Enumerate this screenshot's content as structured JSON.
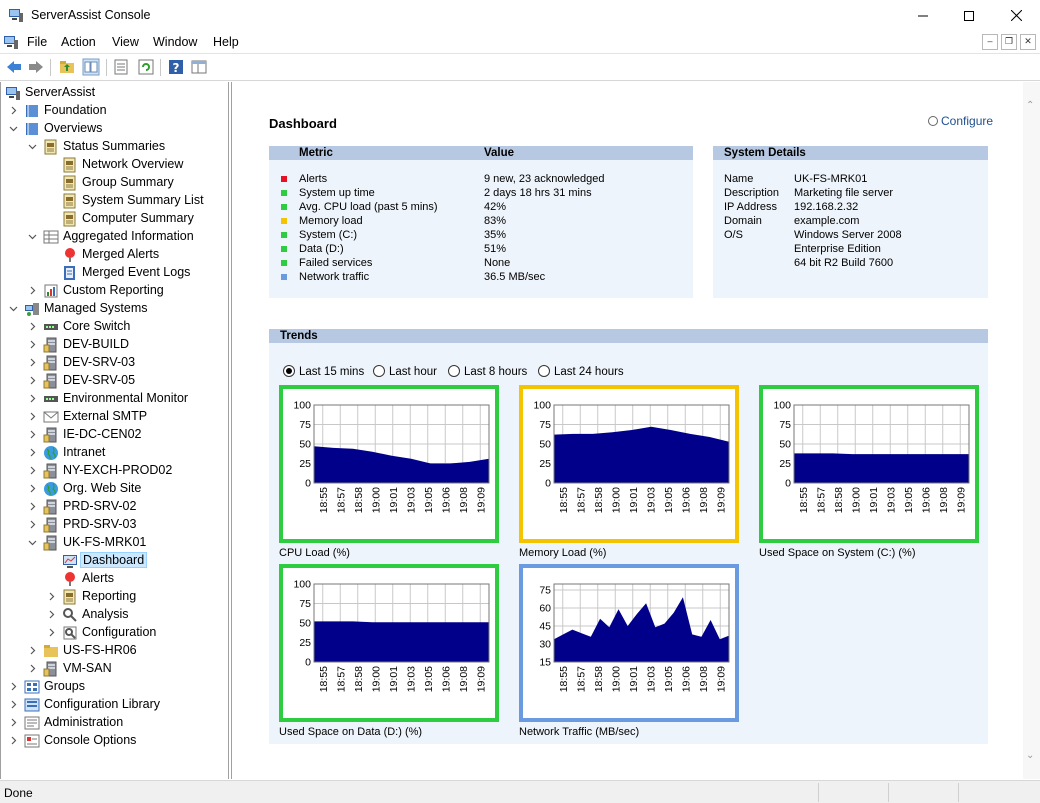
{
  "window": {
    "title": "ServerAssist Console"
  },
  "menu": [
    "File",
    "Action",
    "View",
    "Window",
    "Help"
  ],
  "toolbar": [
    "back-arrow-icon",
    "forward-arrow-icon",
    "up-folder-icon",
    "show-tree-icon",
    "properties-icon",
    "refresh-icon",
    "help-icon",
    "panel-icon"
  ],
  "tree": [
    {
      "label": "ServerAssist",
      "depth": 0,
      "twisty": "",
      "icon": "computer-icon"
    },
    {
      "label": "Foundation",
      "depth": 1,
      "twisty": "closed",
      "icon": "book-icon"
    },
    {
      "label": "Overviews",
      "depth": 1,
      "twisty": "open",
      "icon": "book-icon"
    },
    {
      "label": "Status Summaries",
      "depth": 2,
      "twisty": "open",
      "icon": "report-icon"
    },
    {
      "label": "Network Overview",
      "depth": 3,
      "twisty": "",
      "icon": "report-icon"
    },
    {
      "label": "Group Summary",
      "depth": 3,
      "twisty": "",
      "icon": "report-icon"
    },
    {
      "label": "System Summary List",
      "depth": 3,
      "twisty": "",
      "icon": "report-icon"
    },
    {
      "label": "Computer Summary",
      "depth": 3,
      "twisty": "",
      "icon": "report-icon"
    },
    {
      "label": "Aggregated Information",
      "depth": 2,
      "twisty": "open",
      "icon": "grid-icon"
    },
    {
      "label": "Merged Alerts",
      "depth": 3,
      "twisty": "",
      "icon": "alert-icon"
    },
    {
      "label": "Merged Event Logs",
      "depth": 3,
      "twisty": "",
      "icon": "event-log-icon"
    },
    {
      "label": "Custom Reporting",
      "depth": 2,
      "twisty": "closed",
      "icon": "chart-icon"
    },
    {
      "label": "Managed Systems",
      "depth": 1,
      "twisty": "open",
      "icon": "systems-icon"
    },
    {
      "label": "Core Switch",
      "depth": 2,
      "twisty": "closed",
      "icon": "switch-icon"
    },
    {
      "label": "DEV-BUILD",
      "depth": 2,
      "twisty": "closed",
      "icon": "server-icon"
    },
    {
      "label": "DEV-SRV-03",
      "depth": 2,
      "twisty": "closed",
      "icon": "server-icon"
    },
    {
      "label": "DEV-SRV-05",
      "depth": 2,
      "twisty": "closed",
      "icon": "server-icon"
    },
    {
      "label": "Environmental Monitor",
      "depth": 2,
      "twisty": "closed",
      "icon": "switch-icon"
    },
    {
      "label": "External SMTP",
      "depth": 2,
      "twisty": "closed",
      "icon": "mail-icon"
    },
    {
      "label": "IE-DC-CEN02",
      "depth": 2,
      "twisty": "closed",
      "icon": "server-icon"
    },
    {
      "label": "Intranet",
      "depth": 2,
      "twisty": "closed",
      "icon": "globe-icon"
    },
    {
      "label": "NY-EXCH-PROD02",
      "depth": 2,
      "twisty": "closed",
      "icon": "server-icon"
    },
    {
      "label": "Org. Web Site",
      "depth": 2,
      "twisty": "closed",
      "icon": "globe-icon"
    },
    {
      "label": "PRD-SRV-02",
      "depth": 2,
      "twisty": "closed",
      "icon": "server-icon"
    },
    {
      "label": "PRD-SRV-03",
      "depth": 2,
      "twisty": "closed",
      "icon": "server-icon"
    },
    {
      "label": "UK-FS-MRK01",
      "depth": 2,
      "twisty": "open",
      "icon": "server-icon"
    },
    {
      "label": "Dashboard",
      "depth": 3,
      "twisty": "",
      "icon": "dashboard-icon",
      "selected": true
    },
    {
      "label": "Alerts",
      "depth": 3,
      "twisty": "",
      "icon": "alert-icon"
    },
    {
      "label": "Reporting",
      "depth": 3,
      "twisty": "closed",
      "icon": "report-icon"
    },
    {
      "label": "Analysis",
      "depth": 3,
      "twisty": "closed",
      "icon": "analysis-icon"
    },
    {
      "label": "Configuration",
      "depth": 3,
      "twisty": "closed",
      "icon": "configuration-icon"
    },
    {
      "label": "US-FS-HR06",
      "depth": 2,
      "twisty": "closed",
      "icon": "folder-icon"
    },
    {
      "label": "VM-SAN",
      "depth": 2,
      "twisty": "closed",
      "icon": "server-icon"
    },
    {
      "label": "Groups",
      "depth": 1,
      "twisty": "closed",
      "icon": "groups-icon"
    },
    {
      "label": "Configuration Library",
      "depth": 1,
      "twisty": "closed",
      "icon": "library-icon"
    },
    {
      "label": "Administration",
      "depth": 1,
      "twisty": "closed",
      "icon": "admin-icon"
    },
    {
      "label": "Console Options",
      "depth": 1,
      "twisty": "closed",
      "icon": "options-icon"
    }
  ],
  "dashboard": {
    "title": "Dashboard",
    "configure_label": "Configure",
    "metrics_header": {
      "metric": "Metric",
      "value": "Value"
    },
    "metrics": [
      {
        "name": "Alerts",
        "value": "9 new, 23 acknowledged",
        "status": "#e81123"
      },
      {
        "name": "System up time",
        "value": "2 days 18 hrs 31 mins",
        "status": "#2ecc40"
      },
      {
        "name": "Avg. CPU load (past 5 mins)",
        "value": "42%",
        "status": "#2ecc40"
      },
      {
        "name": "Memory load",
        "value": "83%",
        "status": "#f5c400"
      },
      {
        "name": "System (C:)",
        "value": "35%",
        "status": "#2ecc40"
      },
      {
        "name": "Data (D:)",
        "value": "51%",
        "status": "#2ecc40"
      },
      {
        "name": "Failed services",
        "value": "None",
        "status": "#2ecc40"
      },
      {
        "name": "Network traffic",
        "value": "36.5 MB/sec",
        "status": "#6a9ae0"
      }
    ],
    "system_details_header": "System Details",
    "system_details": [
      {
        "name": "Name",
        "value": "UK-FS-MRK01"
      },
      {
        "name": "Description",
        "value": "Marketing file server"
      },
      {
        "name": "IP Address",
        "value": "192.168.2.32"
      },
      {
        "name": "Domain",
        "value": "example.com"
      },
      {
        "name": "O/S",
        "value": "Windows Server 2008"
      },
      {
        "name": "",
        "value": "Enterprise Edition"
      },
      {
        "name": "",
        "value": "64 bit R2 Build 7600"
      }
    ],
    "trends_header": "Trends",
    "ranges": [
      {
        "label": "Last 15 mins",
        "selected": true
      },
      {
        "label": "Last hour",
        "selected": false
      },
      {
        "label": "Last 8 hours",
        "selected": false
      },
      {
        "label": "Last 24 hours",
        "selected": false
      }
    ]
  },
  "chart_data": [
    {
      "type": "area",
      "title": "CPU Load (%)",
      "status_color": "#2ecc40",
      "x": [
        "18:55",
        "18:57",
        "18:58",
        "19:00",
        "19:01",
        "19:03",
        "19:05",
        "19:06",
        "19:08",
        "19:09"
      ],
      "yticks": [
        0,
        25,
        50,
        75,
        100
      ],
      "ylim": [
        0,
        100
      ],
      "values": [
        47,
        45,
        44,
        40,
        35,
        31,
        25,
        25,
        27,
        31
      ],
      "grid": true
    },
    {
      "type": "area",
      "title": "Memory Load (%)",
      "status_color": "#f5c400",
      "x": [
        "18:55",
        "18:57",
        "18:58",
        "19:00",
        "19:01",
        "19:03",
        "19:05",
        "19:06",
        "19:08",
        "19:09"
      ],
      "yticks": [
        0,
        25,
        50,
        75,
        100
      ],
      "ylim": [
        0,
        100
      ],
      "values": [
        62,
        63,
        63,
        65,
        68,
        72,
        68,
        63,
        59,
        53
      ],
      "grid": true
    },
    {
      "type": "area",
      "title": "Used Space on System (C:) (%)",
      "status_color": "#2ecc40",
      "x": [
        "18:55",
        "18:57",
        "18:58",
        "19:00",
        "19:01",
        "19:03",
        "19:05",
        "19:06",
        "19:08",
        "19:09"
      ],
      "yticks": [
        0,
        25,
        50,
        75,
        100
      ],
      "ylim": [
        0,
        100
      ],
      "values": [
        38,
        38,
        38,
        37,
        37,
        37,
        37,
        37,
        37,
        37
      ],
      "grid": true
    },
    {
      "type": "area",
      "title": "Used Space on Data (D:) (%)",
      "status_color": "#2ecc40",
      "x": [
        "18:55",
        "18:57",
        "18:58",
        "19:00",
        "19:01",
        "19:03",
        "19:05",
        "19:06",
        "19:08",
        "19:09"
      ],
      "yticks": [
        0,
        25,
        50,
        75,
        100
      ],
      "ylim": [
        0,
        100
      ],
      "values": [
        52,
        52,
        52,
        51,
        51,
        51,
        51,
        51,
        51,
        51
      ],
      "grid": true
    },
    {
      "type": "area",
      "title": "Network Traffic (MB/sec)",
      "status_color": "#6a9ae0",
      "x": [
        "18:55",
        "18:57",
        "18:58",
        "19:00",
        "19:01",
        "19:03",
        "19:05",
        "19:06",
        "19:08",
        "19:09"
      ],
      "yticks": [
        15,
        30,
        45,
        60,
        75
      ],
      "ylim": [
        15,
        80
      ],
      "values": [
        34,
        38,
        42,
        39,
        36,
        51,
        44,
        59,
        45,
        55,
        64,
        44,
        47,
        56,
        69,
        38,
        36,
        50,
        34,
        37
      ],
      "grid": true
    }
  ],
  "status": {
    "text": "Done"
  }
}
